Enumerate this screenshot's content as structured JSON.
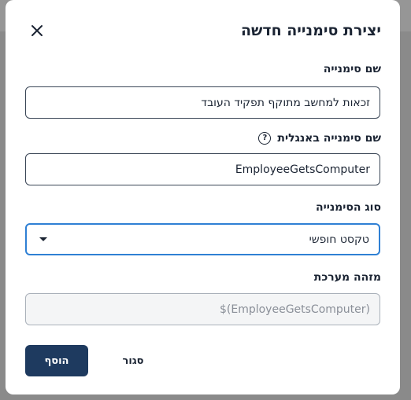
{
  "dialog": {
    "title": "יצירת סימנייה חדשה",
    "close_icon": "close-icon"
  },
  "fields": {
    "bookmark_name": {
      "label": "שם סימנייה",
      "value": "זכאות למחשב מתוקף תפקיד העובד"
    },
    "bookmark_name_english": {
      "label": "שם סימנייה באנגלית",
      "help_icon": "question-icon",
      "help_glyph": "?",
      "value": "EmployeeGetsComputer"
    },
    "bookmark_type": {
      "label": "סוג הסימנייה",
      "selected": "טקסט חופשי"
    },
    "system_id": {
      "label": "מזהה מערכת",
      "value": "$(EmployeeGetsComputer)"
    }
  },
  "actions": {
    "add_label": "הוסף",
    "close_label": "סגור"
  },
  "colors": {
    "primary_button": "#1e3a5f",
    "focus_border": "#2f80d4"
  }
}
